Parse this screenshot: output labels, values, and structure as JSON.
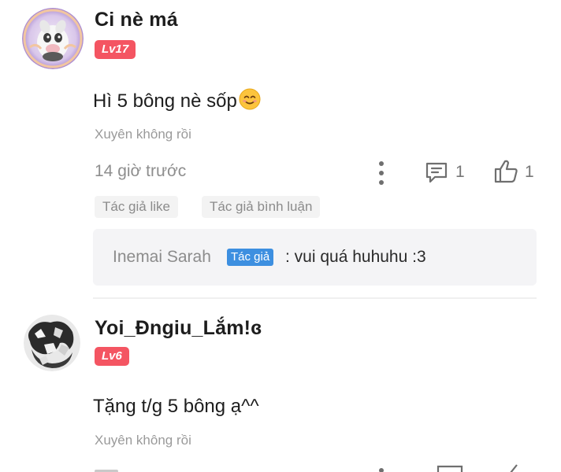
{
  "comments": [
    {
      "username": "Ci nè má",
      "level": "Lv17",
      "text": "Hì 5 bông nè sốp",
      "emoji": "smiling-face-emoji",
      "category": "Xuyên không rồi",
      "time": "14 giờ trước",
      "reply_count": "1",
      "like_count": "1",
      "chips": [
        "Tác giả like",
        "Tác giả bình luận"
      ],
      "reply": {
        "name": "Inemai Sarah",
        "badge": "Tác giả",
        "text": ": vui quá huhuhu :3"
      }
    },
    {
      "username": "Yoi_Đngiu_Lắm!ɞ",
      "level": "Lv6",
      "text": "Tặng t/g 5 bông ạ^^",
      "category": "Xuyên không rồi"
    }
  ],
  "colors": {
    "level_badge": "#f45562",
    "author_badge": "#3d8fe0",
    "reply_box": "#f4f4f6",
    "chip": "#f3f3f3"
  },
  "icons": [
    "more-vertical-icon",
    "comment-icon",
    "thumbs-up-icon"
  ]
}
